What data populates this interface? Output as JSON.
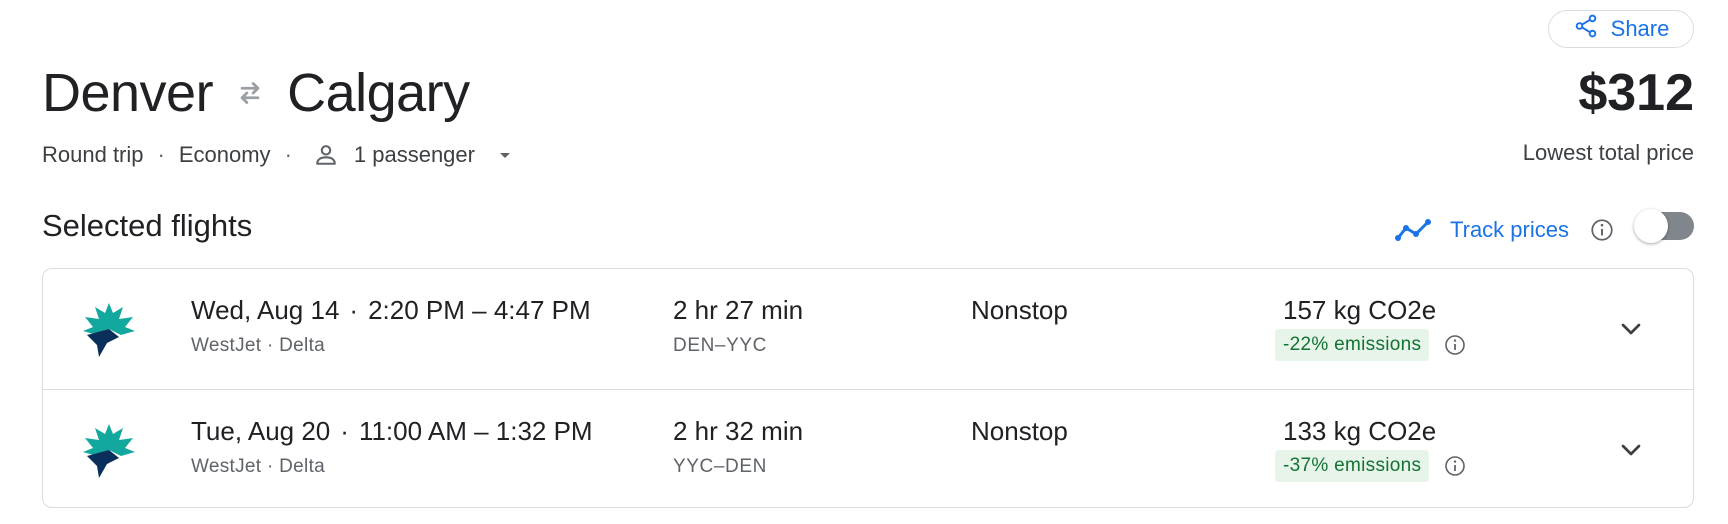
{
  "header": {
    "share_label": "Share",
    "origin": "Denver",
    "destination": "Calgary",
    "price": "$312",
    "price_label": "Lowest total price"
  },
  "trip": {
    "type": "Round trip",
    "separator": "·",
    "cabin": "Economy",
    "passengers": "1 passenger"
  },
  "section": {
    "title": "Selected flights",
    "track_label": "Track prices",
    "track_enabled": false
  },
  "flights": [
    {
      "date": "Wed, Aug 14",
      "times": "2:20 PM – 4:47 PM",
      "carriers": "WestJet · Delta",
      "duration": "2 hr 27 min",
      "airports": "DEN–YYC",
      "stops": "Nonstop",
      "emissions": "157 kg CO2e",
      "emissions_change": "-22% emissions"
    },
    {
      "date": "Tue, Aug 20",
      "times": "11:00 AM – 1:32 PM",
      "carriers": "WestJet · Delta",
      "duration": "2 hr 32 min",
      "airports": "YYC–DEN",
      "stops": "Nonstop",
      "emissions": "133 kg CO2e",
      "emissions_change": "-37% emissions"
    }
  ],
  "icons": {
    "share": "share-icon",
    "swap": "round-trip-arrows-icon",
    "person": "person-icon",
    "caret": "caret-down-icon",
    "trend": "trending-line-icon",
    "info": "info-icon",
    "expand": "chevron-down-icon",
    "airline": "westjet-logo"
  },
  "colors": {
    "accent": "#1a73e8",
    "text": "#202124",
    "secondary": "#5f6368",
    "emission_bg": "#e6f4ea",
    "emission_text": "#137333",
    "logo_teal": "#13a89e",
    "logo_navy": "#0b2f5b"
  }
}
